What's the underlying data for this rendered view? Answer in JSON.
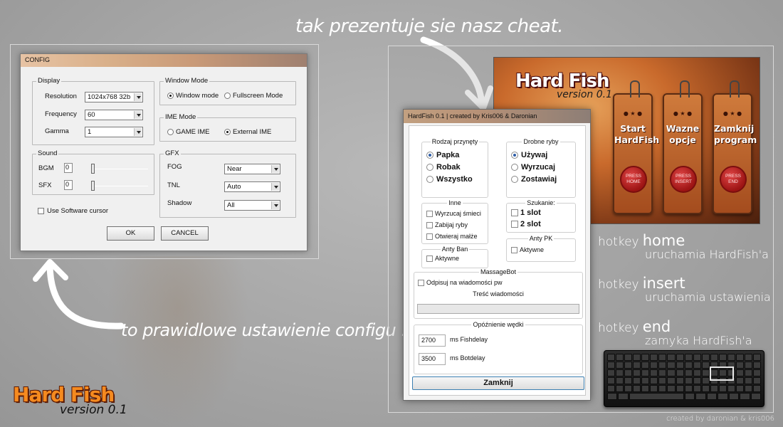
{
  "captions": {
    "top": "tak prezentuje sie nasz cheat.",
    "bottom": "to prawidlowe ustawienie configu .",
    "credits": "created by daronian & kris006"
  },
  "logo": {
    "title": "Hard Fish",
    "version": "version 0.1"
  },
  "config": {
    "title": "CONFIG",
    "display": {
      "title": "Display",
      "resolution_label": "Resolution",
      "resolution_value": "1024x768 32b",
      "frequency_label": "Frequency",
      "frequency_value": "60",
      "gamma_label": "Gamma",
      "gamma_value": "1"
    },
    "window_mode": {
      "title": "Window Mode",
      "option1": "Window mode",
      "option2": "Fullscreen Mode"
    },
    "ime_mode": {
      "title": "IME Mode",
      "option1": "GAME IME",
      "option2": "External IME"
    },
    "sound": {
      "title": "Sound",
      "bgm_label": "BGM",
      "bgm_value": "0",
      "sfx_label": "SFX",
      "sfx_value": "0",
      "bgm_level": 0,
      "sfx_level": 0
    },
    "gfx": {
      "title": "GFX",
      "fog_label": "FOG",
      "fog_value": "Near",
      "tnl_label": "TNL",
      "tnl_value": "Auto",
      "shadow_label": "Shadow",
      "shadow_value": "All"
    },
    "software_cursor": "Use Software cursor",
    "ok": "OK",
    "cancel": "CANCEL"
  },
  "banner": {
    "title": "Hard Fish",
    "version": "version 0.1",
    "tags": [
      {
        "line1": "Start",
        "line2": "HardFish",
        "seal": "PRESS HOME"
      },
      {
        "line1": "Wazne",
        "line2": "opcje",
        "seal": "PRESS INSERT"
      },
      {
        "line1": "Zamknij",
        "line2": "program",
        "seal": "PRESS END"
      }
    ]
  },
  "hardfish": {
    "title": "HardFish 0.1 | created by Kris006 & Daronian",
    "bait": {
      "title": "Rodzaj przynęty",
      "options": [
        "Papka",
        "Robak",
        "Wszystko"
      ]
    },
    "small_fish": {
      "title": "Drobne ryby",
      "options": [
        "Używaj",
        "Wyrzucaj",
        "Zostawiaj"
      ]
    },
    "other": {
      "title": "Inne",
      "options": [
        "Wyrzucaj śmieci",
        "Zabijaj ryby",
        "Otwieraj małże"
      ]
    },
    "search": {
      "title": "Szukanie:",
      "options": [
        "1 slot",
        "2 slot"
      ]
    },
    "anti_pk": {
      "title": "Anty PK",
      "option": "Aktywne"
    },
    "anti_ban": {
      "title": "Anty Ban",
      "option": "Aktywne"
    },
    "massagebot": {
      "title": "MassageBot",
      "reply_label": "Odpisuj na wiadomości pw",
      "message_label": "Treść wiadomości",
      "message_value": ""
    },
    "delay": {
      "title": "Opóźnienie wędki",
      "fish_value": "2700",
      "fish_label": "ms Fishdelay",
      "bot_value": "3500",
      "bot_label": "ms Botdelay"
    },
    "close": "Zamknij"
  },
  "hotkeys": [
    {
      "prefix": "hotkey",
      "key": "home",
      "desc": "uruchamia HardFish'a"
    },
    {
      "prefix": "hotkey",
      "key": "insert",
      "desc": "uruchamia ustawienia"
    },
    {
      "prefix": "hotkey",
      "key": "end",
      "desc": "zamyka HardFish'a"
    }
  ]
}
